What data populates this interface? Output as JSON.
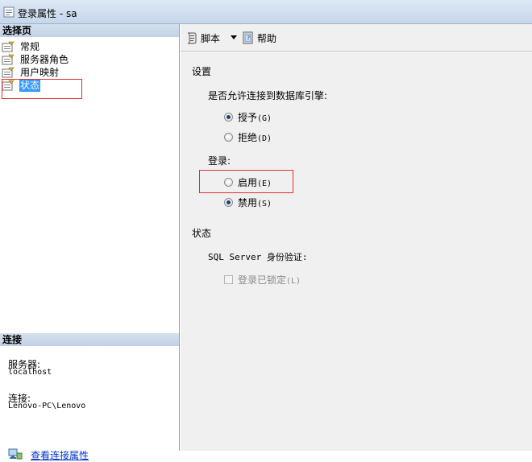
{
  "window": {
    "title": "登录属性 - sa"
  },
  "left_pane": {
    "pages_header": "选择页",
    "pages": [
      {
        "label": "常规",
        "icon": "page-icon",
        "selected": false
      },
      {
        "label": "服务器角色",
        "icon": "page-icon",
        "selected": false
      },
      {
        "label": "用户映射",
        "icon": "page-icon",
        "selected": false
      },
      {
        "label": "状态",
        "icon": "page-icon",
        "selected": true
      }
    ],
    "connection_header": "连接",
    "server_label": "服务器:",
    "server_value": "localhost",
    "connection_label": "连接:",
    "connection_value": "Lenovo-PC\\Lenovo",
    "view_connection_link": "查看连接属性"
  },
  "toolbar": {
    "script_label": "脚本",
    "help_label": "帮助"
  },
  "settings": {
    "section_title": "设置",
    "db_engine_question": "是否允许连接到数据库引擎:",
    "grant_label": "授予",
    "grant_mnemonic": "(G)",
    "grant_checked": true,
    "deny_label": "拒绝",
    "deny_mnemonic": "(D)",
    "deny_checked": false,
    "login_label": "登录:",
    "enable_label": "启用",
    "enable_mnemonic": "(E)",
    "enable_checked": false,
    "disable_label": "禁用",
    "disable_mnemonic": "(S)",
    "disable_checked": true
  },
  "status": {
    "section_title": "状态",
    "auth_label": "SQL Server 身份验证:",
    "locked_label": "登录已锁定",
    "locked_mnemonic": "(L)",
    "locked_checked": false,
    "locked_enabled": false
  },
  "colors": {
    "selection": "#3399ff",
    "highlight_box": "#e03030",
    "link": "#0033cc",
    "header_bg": "#c1d1e5"
  }
}
